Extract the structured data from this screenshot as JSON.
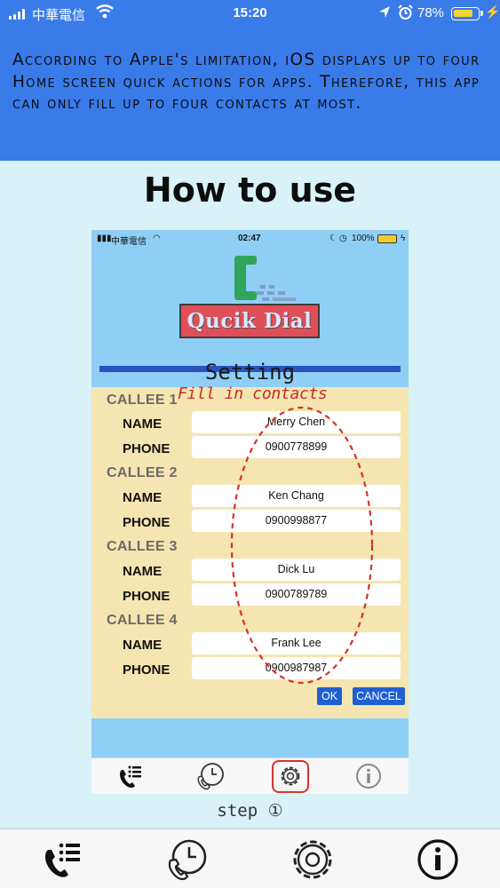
{
  "status": {
    "carrier": "中華電信",
    "time": "15:20",
    "battery": "78%",
    "battery_level": 0.78
  },
  "banner": {
    "text": "According to Apple's limitation,  iOS displays up to four Home screen quick actions for apps. Therefore, this app can only fill up to four contacts at most."
  },
  "heading": "How to use",
  "inner": {
    "status": {
      "carrier": "中華電信",
      "time": "02:47",
      "battery": "100%",
      "battery_level": 1.0
    },
    "logo_text": "Qucik Dial",
    "setting_title": "Setting",
    "annotation": "Fill in contacts",
    "callees": [
      {
        "title": "CALLEE 1",
        "name_label": "NAME",
        "phone_label": "PHONE",
        "name": "Merry Chen",
        "phone": "0900778899"
      },
      {
        "title": "CALLEE 2",
        "name_label": "NAME",
        "phone_label": "PHONE",
        "name": "Ken Chang",
        "phone": "0900998877"
      },
      {
        "title": "CALLEE 3",
        "name_label": "NAME",
        "phone_label": "PHONE",
        "name": "Dick Lu",
        "phone": "0900789789"
      },
      {
        "title": "CALLEE 4",
        "name_label": "NAME",
        "phone_label": "PHONE",
        "name": "Frank  Lee",
        "phone": "0900987987"
      }
    ],
    "ok_label": "OK",
    "cancel_label": "CANCEL",
    "tabs": [
      "contacts-list-icon",
      "history-phone-icon",
      "settings-gear-icon",
      "info-icon"
    ]
  },
  "step_label": "step ①",
  "tabs": [
    "contacts-list-icon",
    "history-phone-icon",
    "settings-gear-icon",
    "info-icon"
  ],
  "colors": {
    "accent_blue": "#3a7bea",
    "page_bg": "#d8f2f7",
    "form_bg": "#f5e5b1",
    "highlight_red": "#d4332a",
    "button_blue": "#1f5fd3"
  }
}
